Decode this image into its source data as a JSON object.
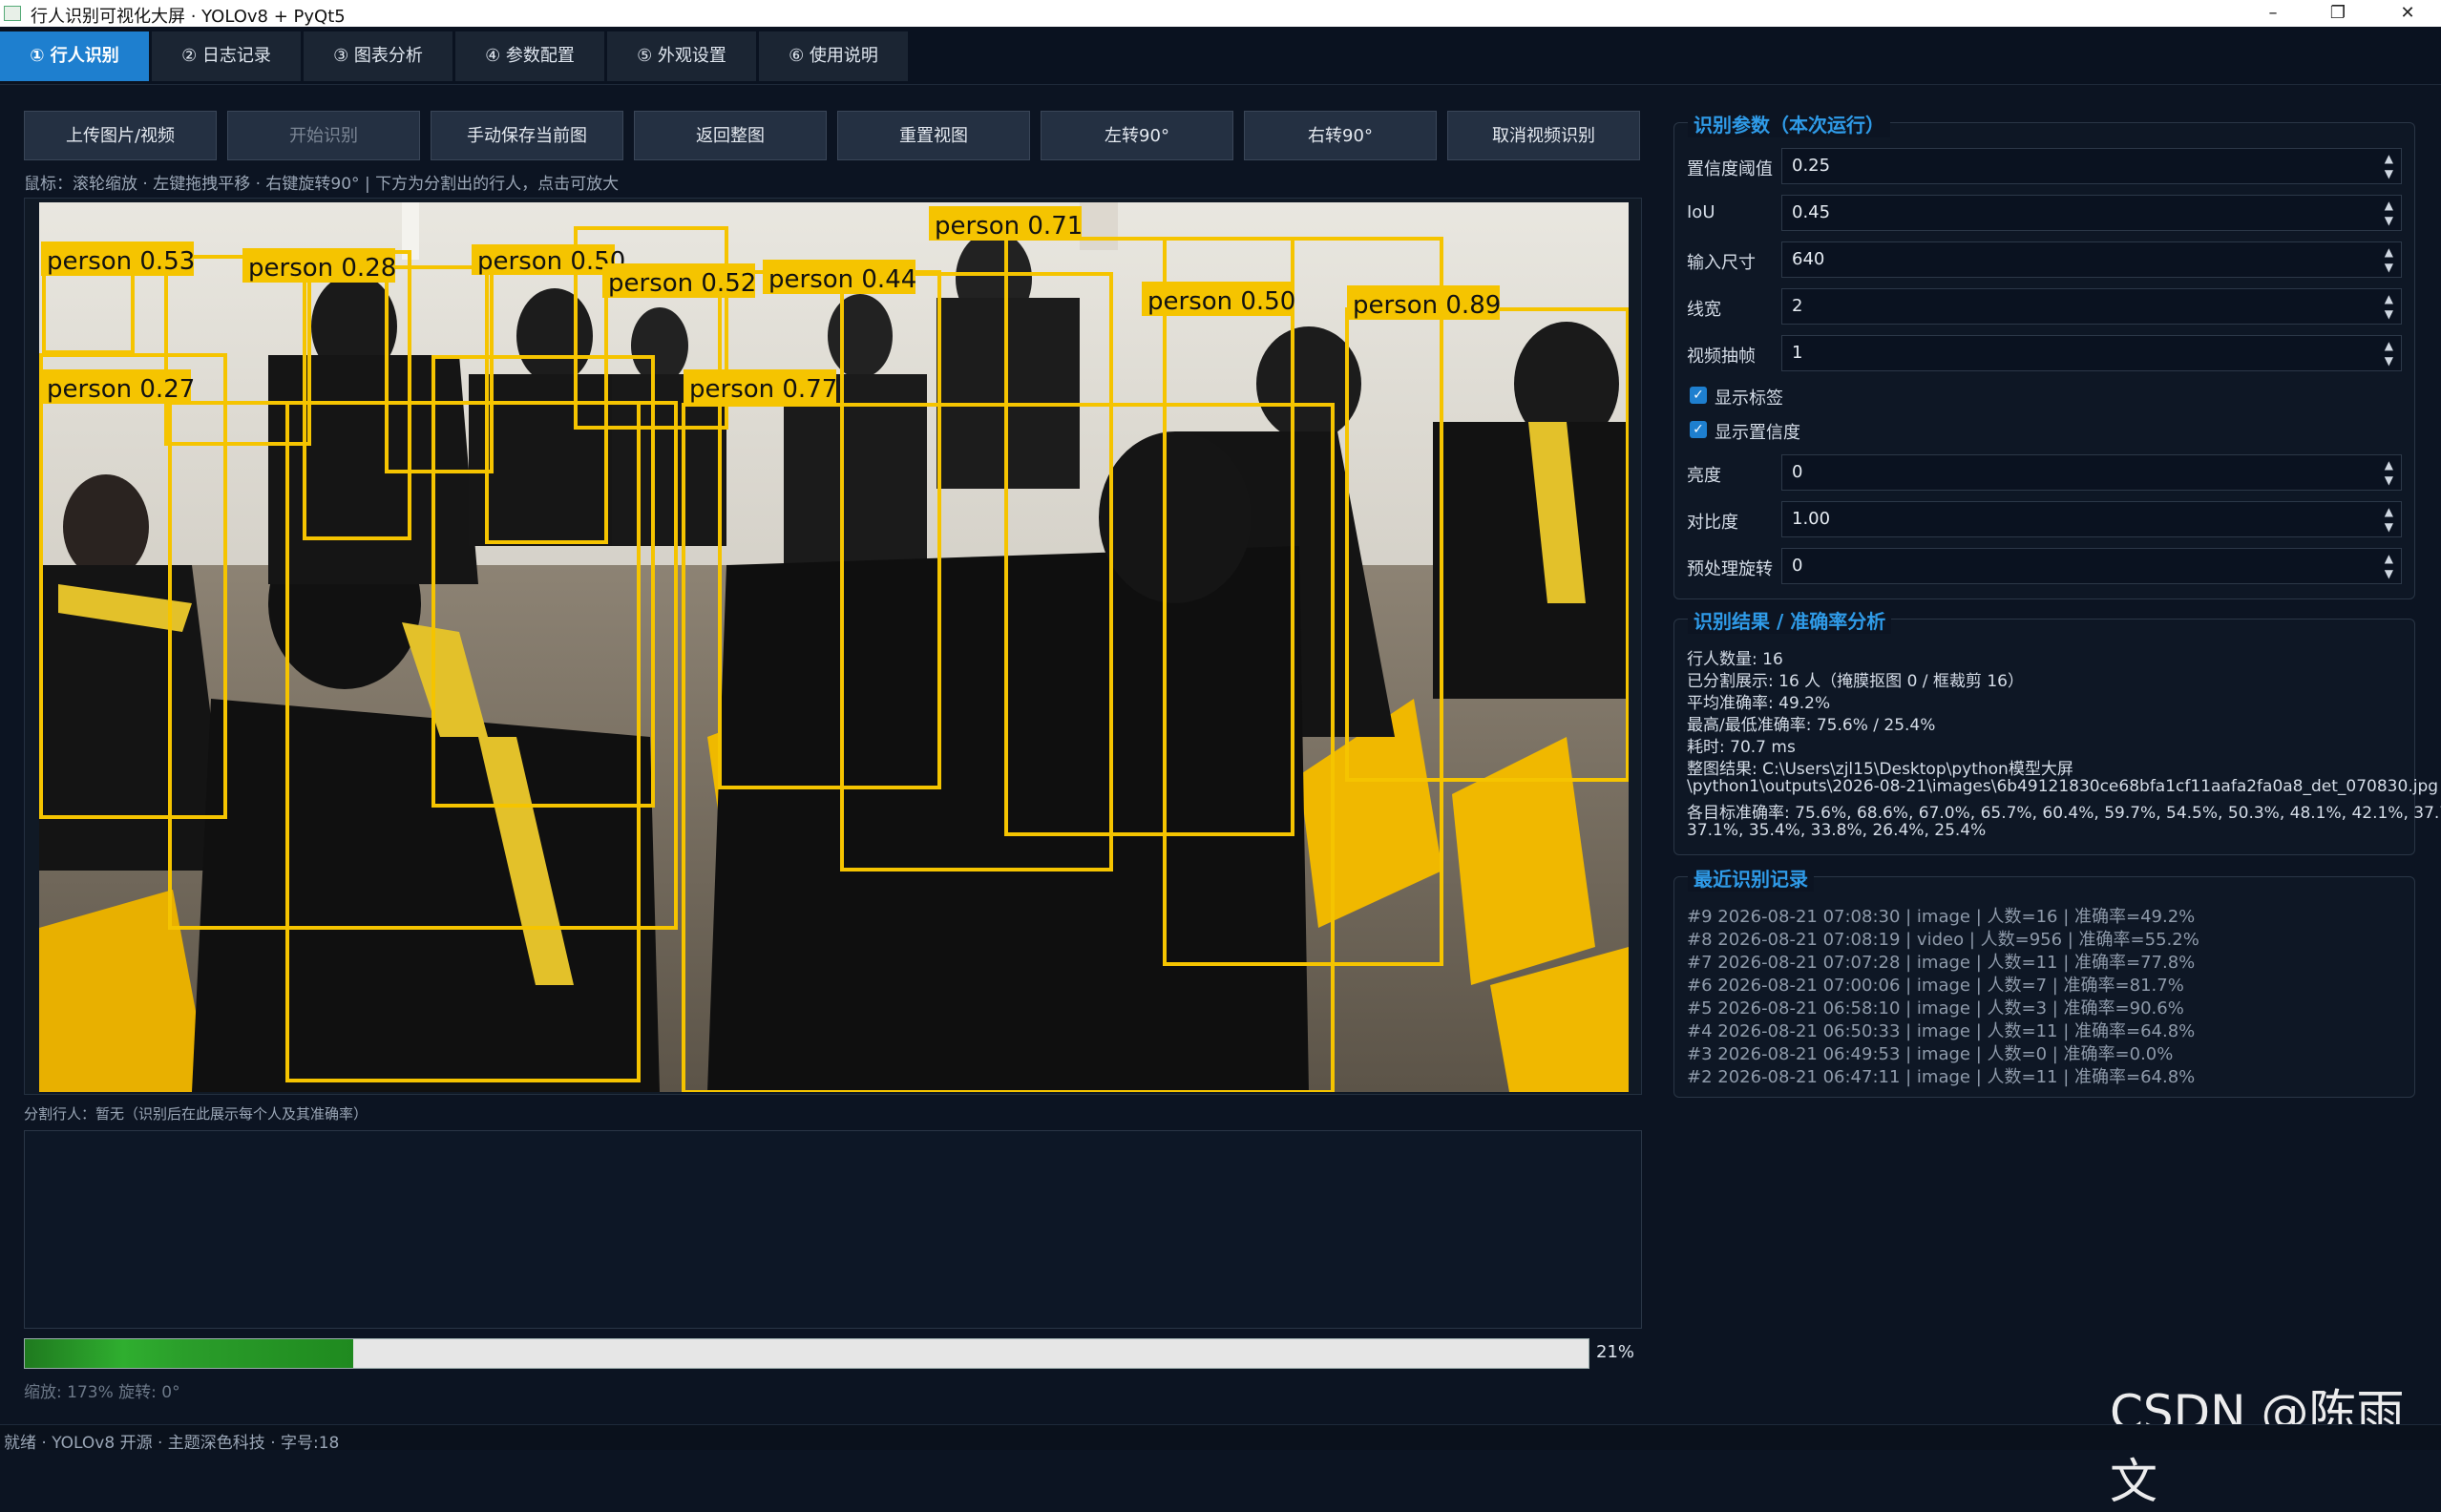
{
  "window": {
    "title": "行人识别可视化大屏 · YOLOv8 + PyQt5",
    "min": "–",
    "max": "❐",
    "close": "✕"
  },
  "tabs": [
    "① 行人识别",
    "② 日志记录",
    "③ 图表分析",
    "④ 参数配置",
    "⑤ 外观设置",
    "⑥ 使用说明"
  ],
  "toolbar": [
    "上传图片/视频",
    "开始识别",
    "手动保存当前图",
    "返回整图",
    "重置视图",
    "左转90°",
    "右转90°",
    "取消视频识别"
  ],
  "hint": "鼠标：滚轮缩放 · 左键拖拽平移 · 右键旋转90°  |  下方为分割出的行人，点击可放大",
  "detections": [
    "person 0.53",
    "person 0.28",
    "person 0.50",
    "person 0.52",
    "person 0.44",
    "person 0.71",
    "person 0.27",
    "person 0.77",
    "person 0.50",
    "person 0.89"
  ],
  "box_color": "#f5c400",
  "seg_label": "分割行人：暂无（识别后在此展示每个人及其准确率）",
  "progress": {
    "value": 0.21,
    "text": "21%"
  },
  "zoom_text": "缩放: 173%  旋转: 0°",
  "status_text": "就绪 · YOLOv8 开源 · 主题深色科技 · 字号:18",
  "params": {
    "title": "识别参数（本次运行）",
    "rows": [
      {
        "label": "置信度阈值",
        "value": "0.25"
      },
      {
        "label": "IoU",
        "value": "0.45"
      },
      {
        "label": "输入尺寸",
        "value": "640"
      },
      {
        "label": "线宽",
        "value": "2"
      },
      {
        "label": "视频抽帧",
        "value": "1"
      }
    ],
    "checks": [
      "显示标签",
      "显示置信度"
    ],
    "rows2": [
      {
        "label": "亮度",
        "value": "0"
      },
      {
        "label": "对比度",
        "value": "1.00"
      },
      {
        "label": "预处理旋转",
        "value": "0"
      }
    ]
  },
  "results": {
    "title": "识别结果 / 准确率分析",
    "lines": [
      "行人数量: 16",
      "已分割展示: 16 人（掩膜抠图 0 / 框裁剪 16）",
      "平均准确率: 49.2%",
      "最高/最低准确率: 75.6% / 25.4%",
      "耗时: 70.7 ms",
      "整图结果: C:\\Users\\zjl15\\Desktop\\python模型大屏",
      "\\python1\\outputs\\2026-08-21\\images\\6b49121830ce68bfa1cf11aafa2fa0a8_det_070830.jpg",
      "各目标准确率: 75.6%, 68.6%, 67.0%, 65.7%, 60.4%, 59.7%, 54.5%, 50.3%, 48.1%, 42.1%, 37.7%,",
      "37.1%, 35.4%, 33.8%, 26.4%, 25.4%"
    ]
  },
  "history": {
    "title": "最近识别记录",
    "items": [
      "#9 2026-08-21 07:08:30 | image | 人数=16 | 准确率=49.2%",
      "#8 2026-08-21 07:08:19 | video | 人数=956 | 准确率=55.2%",
      "#7 2026-08-21 07:07:28 | image | 人数=11 | 准确率=77.8%",
      "#6 2026-08-21 07:00:06 | image | 人数=7 | 准确率=81.7%",
      "#5 2026-08-21 06:58:10 | image | 人数=3 | 准确率=90.6%",
      "#4 2026-08-21 06:50:33 | image | 人数=11 | 准确率=64.8%",
      "#3 2026-08-21 06:49:53 | image | 人数=0 | 准确率=0.0%",
      "#2 2026-08-21 06:47:11 | image | 人数=11 | 准确率=64.8%"
    ]
  },
  "watermark": "CSDN @陈雨文"
}
